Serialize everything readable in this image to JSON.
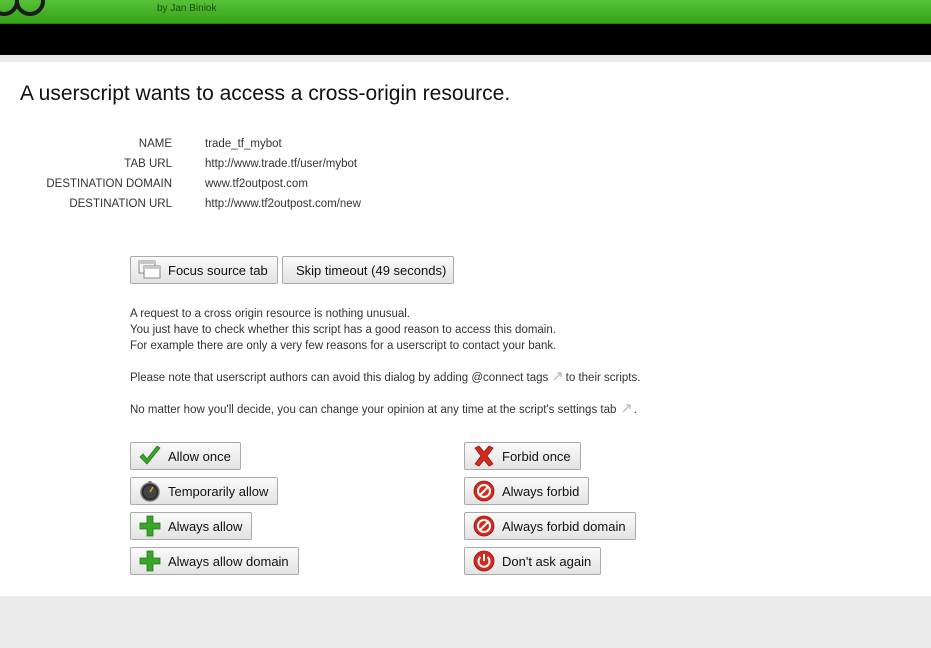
{
  "header": {
    "author": "by Jan Biniok"
  },
  "page": {
    "title": "A userscript wants to access a cross-origin resource."
  },
  "info": [
    {
      "label": "NAME",
      "value": "trade_tf_mybot"
    },
    {
      "label": "TAB URL",
      "value": "http://www.trade.tf/user/mybot"
    },
    {
      "label": "DESTINATION DOMAIN",
      "value": "www.tf2outpost.com"
    },
    {
      "label": "DESTINATION URL",
      "value": "http://www.tf2outpost.com/new"
    }
  ],
  "top_buttons": {
    "focus_source_tab": "Focus source tab",
    "skip_timeout": "Skip timeout (49 seconds)"
  },
  "description": {
    "line1": "A request to a cross origin resource is nothing unusual.",
    "line2": "You just have to check whether this script has a good reason to access this domain.",
    "line3": "For example there are only a very few reasons for a userscript to contact your bank.",
    "note_before": "Please note that userscript authors can avoid this dialog by adding @connect tags",
    "note_after": " to their scripts.",
    "change_before": "No matter how you'll decide, you can change your opinion at any time at the script's settings tab",
    "change_after": "."
  },
  "allow_buttons": {
    "allow_once": "Allow once",
    "temporarily_allow": "Temporarily allow",
    "always_allow": "Always allow",
    "always_allow_domain": "Always allow domain"
  },
  "forbid_buttons": {
    "forbid_once": "Forbid once",
    "always_forbid": "Always forbid",
    "always_forbid_domain": "Always forbid domain",
    "dont_ask_again": "Don't ask again"
  },
  "colors": {
    "header_green": "#3eab1d",
    "allow_green": "#3aa52b",
    "forbid_red": "#d42a1e"
  }
}
